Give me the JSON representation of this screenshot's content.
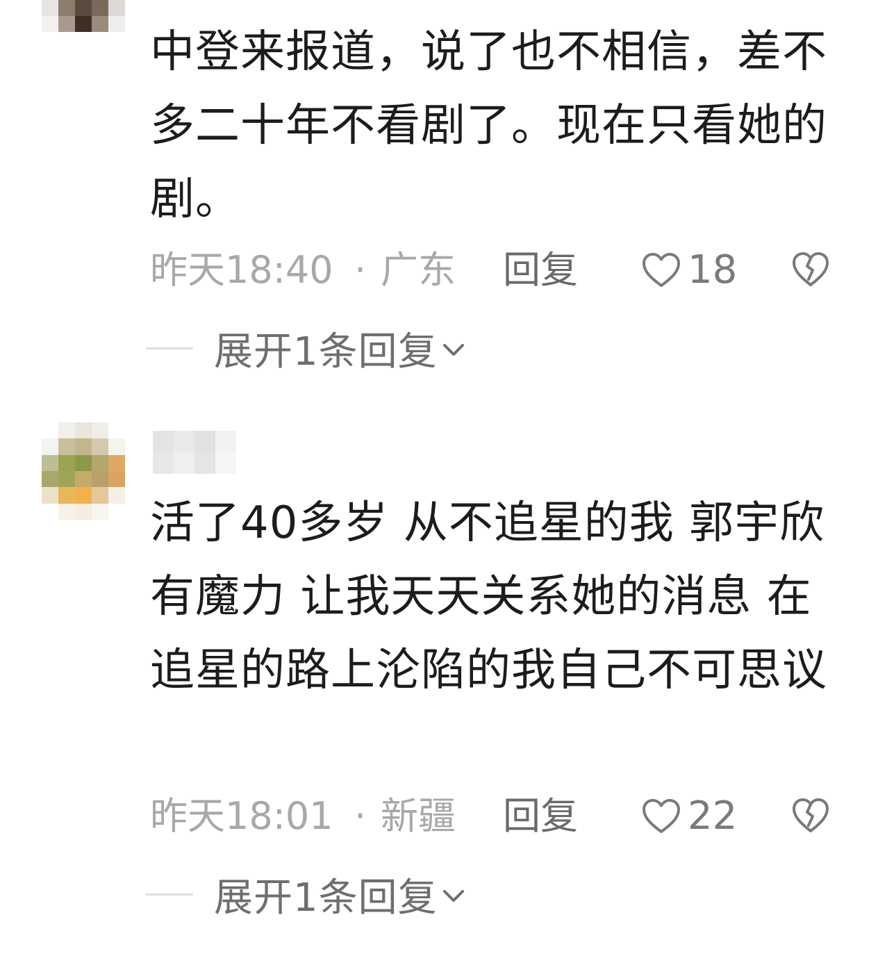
{
  "comments": [
    {
      "text": "中登来报道，说了也不相信，差不多二十年不看剧了。现在只看她的剧。",
      "time": "昨天18:40",
      "separator": "·",
      "region": "广东",
      "reply_label": "回复",
      "likes": "18",
      "expand_label": "展开1条回复"
    },
    {
      "text": "活了40多岁 从不追星的我 郭宇欣有魔力 让我天天关系她的消息 在追星的路上沦陷的我自己不可思议",
      "time": "昨天18:01",
      "separator": "·",
      "region": "新疆",
      "reply_label": "回复",
      "likes": "22",
      "expand_label": "展开1条回复"
    }
  ],
  "icons": {
    "like": "heart-outline-icon",
    "dislike": "broken-heart-icon",
    "expand": "chevron-down-icon"
  },
  "colors": {
    "text": "#1c1c1c",
    "meta": "#a8a8a8",
    "action": "#6a6a6a"
  }
}
